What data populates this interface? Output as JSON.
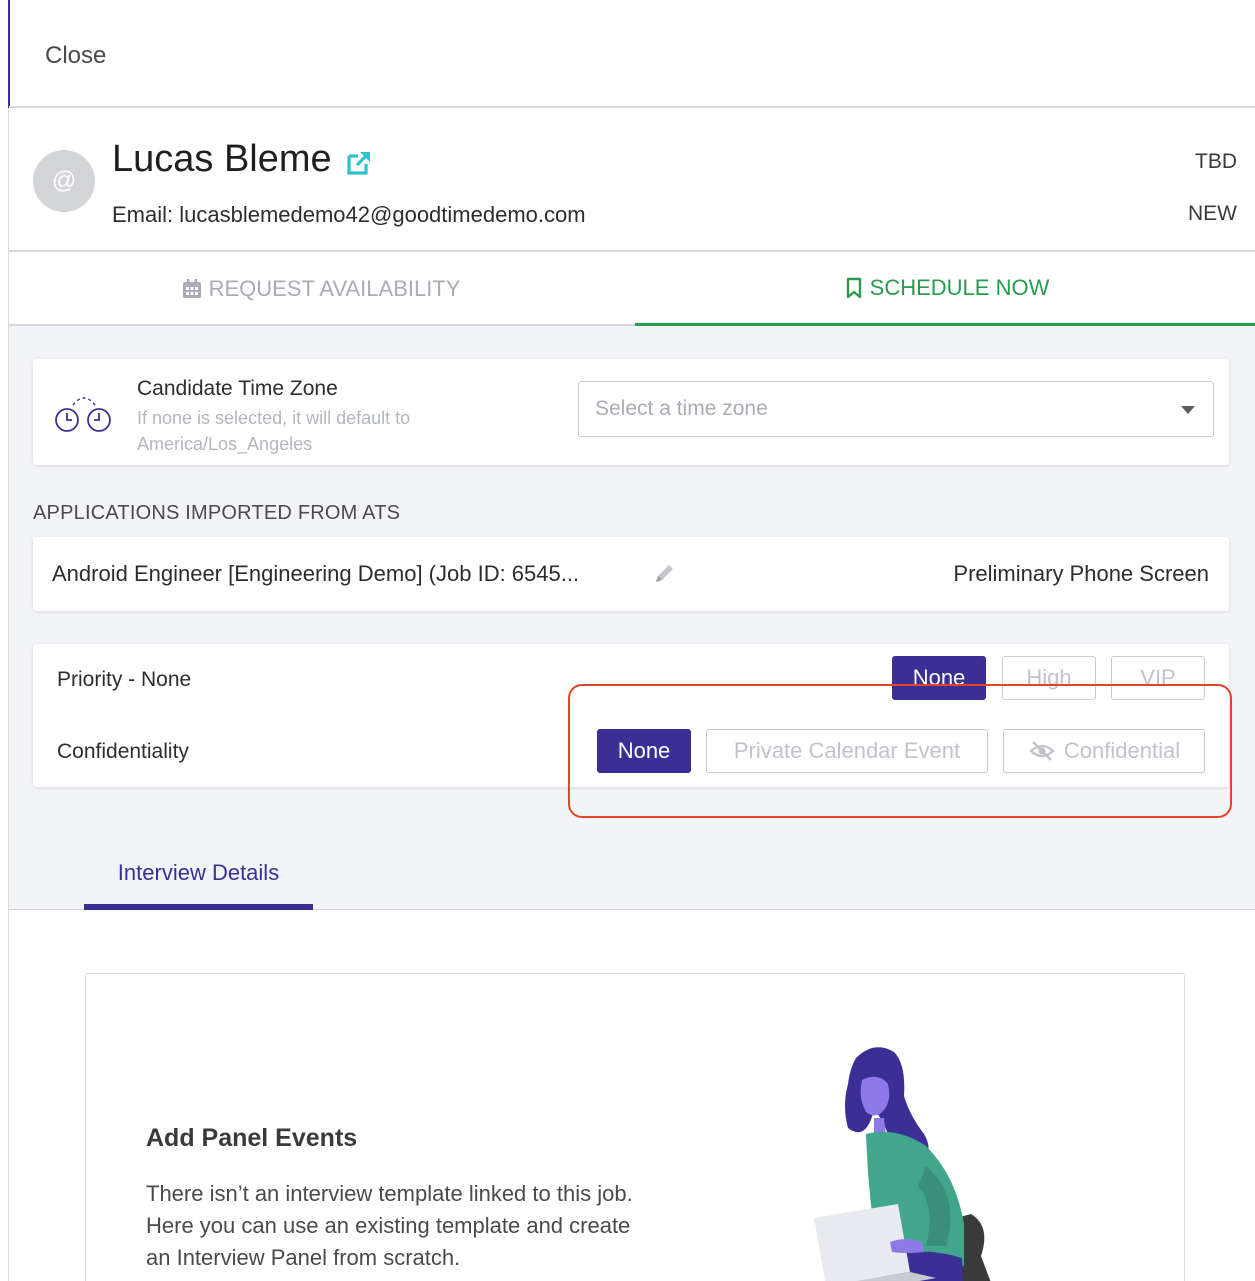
{
  "close_label": "Close",
  "candidate": {
    "avatar_text": "@",
    "name": "Lucas Bleme",
    "email": "Email: lucasblemedemo42@goodtimedemo.com",
    "status_top": "TBD",
    "status_bottom": "NEW"
  },
  "tabs": {
    "request_availability": "REQUEST AVAILABILITY",
    "schedule_now": "SCHEDULE NOW",
    "active": "schedule_now"
  },
  "timezone": {
    "title": "Candidate Time Zone",
    "hint": "If none is selected, it will default to America/Los_Angeles",
    "placeholder": "Select a time zone"
  },
  "applications": {
    "section_label": "APPLICATIONS IMPORTED FROM ATS",
    "title": "Android Engineer [Engineering Demo] (Job ID: 6545...",
    "stage": "Preliminary Phone Screen"
  },
  "priority": {
    "label": "Priority - None",
    "options": [
      "None",
      "High",
      "VIP"
    ],
    "selected": "None"
  },
  "confidentiality": {
    "label": "Confidentiality",
    "options": [
      "None",
      "Private Calendar Event",
      "Confidential"
    ],
    "selected": "None"
  },
  "details_tab": "Interview Details",
  "panel": {
    "title": "Add Panel Events",
    "body": "There isn’t an interview template linked to this job. Here you can use an existing template and create an Interview Panel from scratch."
  },
  "colors": {
    "brand": "#3b2f95",
    "accent_green": "#2a9a4e",
    "link_teal": "#2fc2c9",
    "highlight_red": "#e0452a"
  }
}
